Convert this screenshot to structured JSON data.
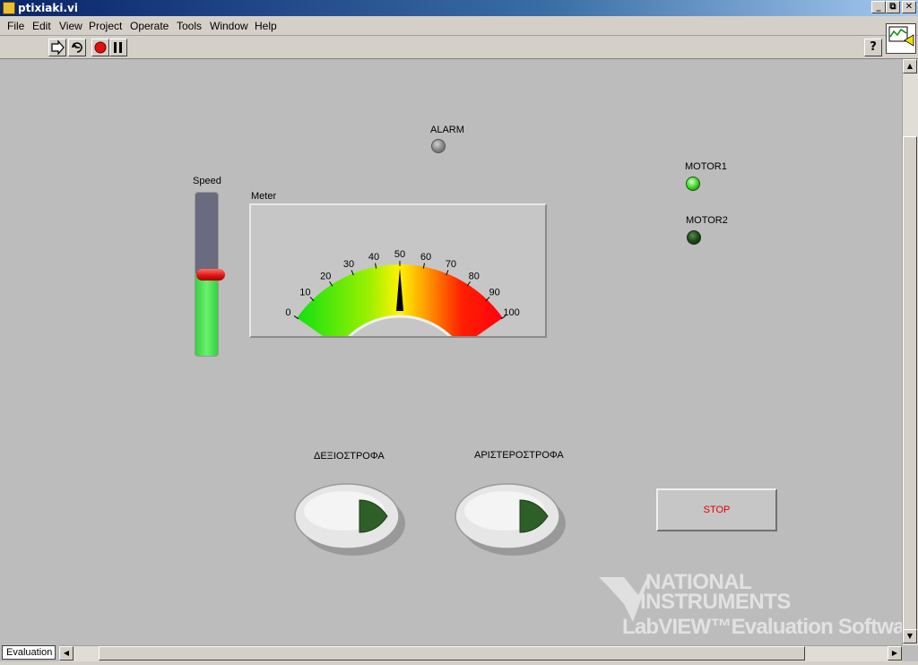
{
  "window": {
    "title": "ptixiaki.vi",
    "controls": [
      "_",
      "⧉",
      "✕"
    ]
  },
  "menu": [
    "File",
    "Edit",
    "View",
    "Project",
    "Operate",
    "Tools",
    "Window",
    "Help"
  ],
  "toolbar": {
    "buttons": [
      "run-arrow-icon",
      "run-continuously-icon",
      "abort-icon",
      "pause-icon"
    ],
    "help_glyph": "?"
  },
  "front_panel": {
    "alarm": {
      "label": "ALARM",
      "state": "off",
      "color": "#8a8a8a"
    },
    "motor1": {
      "label": "MOTOR1",
      "state": "on",
      "color": "#3cdc28"
    },
    "motor2": {
      "label": "MOTOR2",
      "state": "off",
      "color": "#1f4a18"
    },
    "speed": {
      "label": "Speed",
      "level": 0.5,
      "fill_color": "#44e04c"
    },
    "meter": {
      "label": "Meter",
      "min": 0,
      "max": 100,
      "value": 50,
      "ticks": [
        "0",
        "10",
        "20",
        "30",
        "40",
        "50",
        "60",
        "70",
        "80",
        "90",
        "100"
      ]
    },
    "cw_button": {
      "label": "ΔΕΞΙΟΣΤΡΟΦΑ"
    },
    "ccw_button": {
      "label": "ΑΡΙΣΤΕΡΟΣΤΡΟΦΑ"
    },
    "stop_button": {
      "label": "STOP",
      "text_color": "#e00000"
    }
  },
  "status": {
    "tab": "Evaluation"
  },
  "watermark": {
    "line1": "NATIONAL",
    "line2": "INSTRUMENTS",
    "line3": "LabVIEW™Evaluation Software"
  }
}
